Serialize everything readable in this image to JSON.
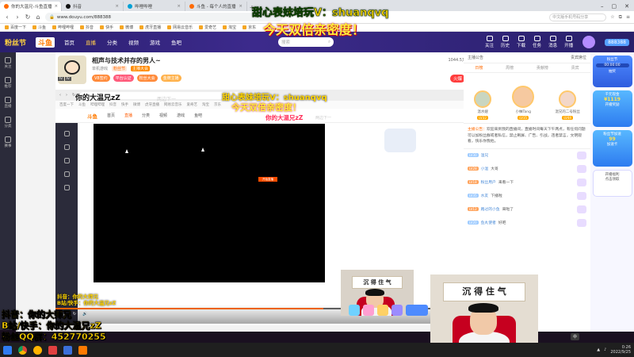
{
  "browser": {
    "tabs": [
      {
        "label": "你的大温兄-斗鱼直播"
      },
      {
        "label": "抖音"
      },
      {
        "label": "哔哩哔哩"
      },
      {
        "label": "斗鱼 - 每个人的直播"
      }
    ],
    "url": "www.douyu.com/888388",
    "search_placeholder": "中文版手机号码分享"
  },
  "bookmarks": [
    "百度一下",
    "斗鱼",
    "哔哩哔哩",
    "抖音",
    "快手",
    "微博",
    "虎牙直播",
    "网易云音乐",
    "爱奇艺",
    "淘宝",
    "京东"
  ],
  "site": {
    "logo_left": "粉丝节",
    "logo_right": "斗鱼",
    "nav": [
      "首页",
      "直播",
      "分类",
      "视频",
      "游戏",
      "鱼吧"
    ],
    "nav_active": "直播",
    "search_placeholder": "搜索",
    "right_icons": [
      "关注",
      "历史",
      "下载",
      "任务",
      "消息",
      "开播"
    ],
    "room_id": "888388"
  },
  "siderail": [
    "关注",
    "推荐",
    "直播",
    "分类",
    "赛事"
  ],
  "room": {
    "title": "相声与技术并存的男人~",
    "category": "单机游戏",
    "hot_tag": "粉丝节",
    "meta_tag": "主播大会",
    "badges": [
      {
        "label": "V8签约",
        "color": "#ff8a3a"
      },
      {
        "label": "平台认证",
        "color": "#ff5a7a"
      },
      {
        "label": "粉丝大会",
        "color": "#ff8a3a"
      },
      {
        "label": "金牌主播",
        "color": "#ffb14a"
      }
    ],
    "levels": [
      "lv",
      "lv",
      "lv"
    ],
    "follow": "关注",
    "report": "举报",
    "hot_value": "火爆",
    "follow_count": "1044.5万"
  },
  "inner": {
    "header_logo": "斗鱼",
    "header_nav": [
      "首页",
      "直播",
      "分类",
      "视频",
      "游戏",
      "鱼吧"
    ],
    "video_button": "开始直播"
  },
  "overlay": {
    "wechat": "甜心表妹培玩V：shuanqvq",
    "today": "今天双倍亲密度！",
    "streamer_name": "你的大温兄zZ",
    "streamer_subname": "两边下一"
  },
  "inner_overlay": [
    "抖音：你的大师兄",
    "B站/快手：你的大温兄zZ"
  ],
  "bottom_overlay": [
    "抖音：你的大师兄",
    "B站/快手：你的大温兄zZ",
    "粉丝QQ群：452770255"
  ],
  "rightpanel": {
    "head_left": "主播公告",
    "head_right": "贵宾席位",
    "tabs": [
      "日榜",
      "周榜",
      "贡献榜",
      "贵宾"
    ],
    "tab_active": "日榜",
    "ranks": [
      {
        "name": "温水嫂",
        "lv": "LV32"
      },
      {
        "name": "小柚Tang",
        "lv": "LV35"
      },
      {
        "name": "温兄的二号粉丝",
        "lv": "LV44"
      }
    ],
    "notice_label": "主播公告：",
    "notice": "欢迎来到我的直播间，直播时间每天下午两点，有任何问题可以加粉丝群或者私信，禁止刷屏、广告、引战，违者禁言，文明观看，快乐你我他。",
    "messages": [
      {
        "lv": "LV30",
        "orange": false,
        "name": "温兄",
        "text": ""
      },
      {
        "lv": "LV28",
        "orange": true,
        "name": "小温",
        "text": "大哥"
      },
      {
        "lv": "LV18",
        "orange": true,
        "name": "粉丝用户",
        "text": "来看一下"
      },
      {
        "lv": "LV35",
        "orange": false,
        "name": "水友",
        "text": "下播啦"
      },
      {
        "lv": "LV12",
        "orange": true,
        "name": "路过的小鱼",
        "text": "来啦了"
      },
      {
        "lv": "LV20",
        "orange": false,
        "name": "鱼丸使者",
        "text": "好吧"
      }
    ]
  },
  "promo": [
    {
      "kind": "blue",
      "title": "粉丝节",
      "sub": "抽奖",
      "time": "00:00:00"
    },
    {
      "kind": "teal",
      "title": "千元现金",
      "big": "¥1119",
      "sub": "开播奖励"
    },
    {
      "kind": "teal",
      "title": "粉丝节加速",
      "big": "99",
      "sub": "加速卡"
    },
    {
      "kind": "white",
      "title": "开播福利",
      "sub": "点击领取"
    }
  ],
  "calligraphy": "沉 得 住 气",
  "taskbar": {
    "time": "0:26",
    "date": "2022/9/25",
    "tray_app_label": "中"
  },
  "colors": {
    "douyu_orange": "#ff6a00",
    "overlay_yellow": "#ffd400",
    "header_purple": "#3c2a8c"
  }
}
